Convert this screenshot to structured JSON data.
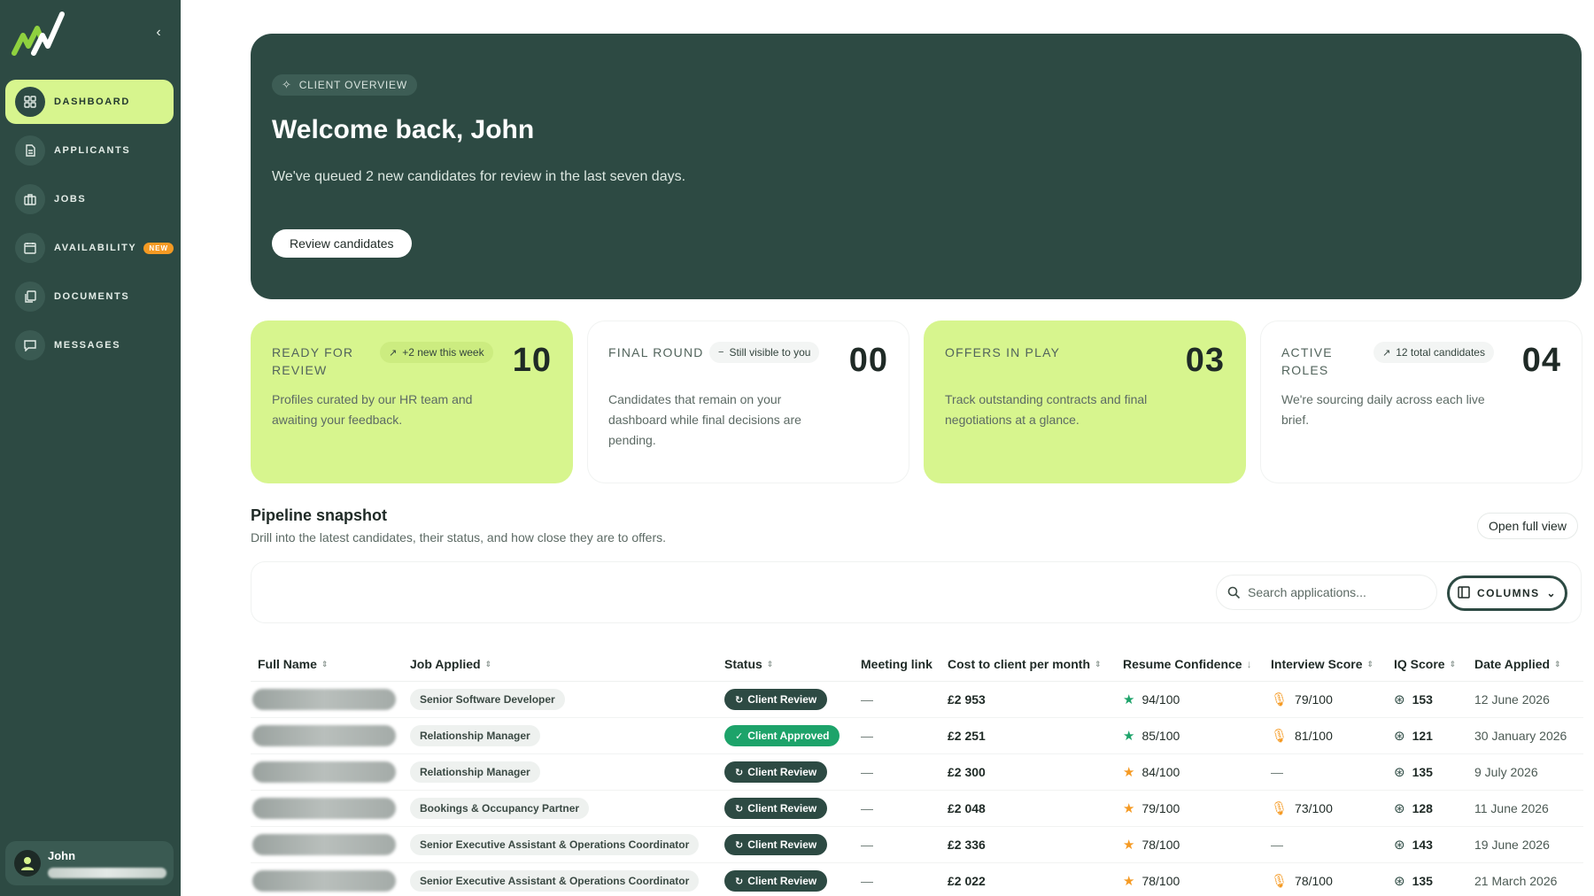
{
  "sidebar": {
    "items": [
      {
        "label": "DASHBOARD",
        "icon": "grid-icon",
        "active": true
      },
      {
        "label": "APPLICANTS",
        "icon": "file-icon"
      },
      {
        "label": "JOBS",
        "icon": "briefcase-icon"
      },
      {
        "label": "AVAILABILITY",
        "icon": "calendar-icon",
        "badge": "NEW"
      },
      {
        "label": "DOCUMENTS",
        "icon": "documents-icon"
      },
      {
        "label": "MESSAGES",
        "icon": "message-icon"
      }
    ],
    "user": {
      "name": "John"
    }
  },
  "hero": {
    "chip": "CLIENT OVERVIEW",
    "title": "Welcome back, John",
    "subtitle": "We've queued 2 new candidates for review in the last seven days.",
    "button": "Review candidates"
  },
  "stats": [
    {
      "label": "READY FOR REVIEW",
      "tag": "+2 new this week",
      "value": "10",
      "desc": "Profiles curated by our HR team and awaiting your feedback."
    },
    {
      "label": "FINAL ROUND",
      "tag": "Still visible to you",
      "value": "00",
      "desc": "Candidates that remain on your dashboard while final decisions are pending."
    },
    {
      "label": "OFFERS IN PLAY",
      "tag": "",
      "value": "03",
      "desc": "Track outstanding contracts and final negotiations at a glance."
    },
    {
      "label": "ACTIVE ROLES",
      "tag": "12 total candidates",
      "value": "04",
      "desc": "We're sourcing daily across each live brief."
    }
  ],
  "pipeline": {
    "title": "Pipeline snapshot",
    "subtitle": "Drill into the latest candidates, their status, and how close they are to offers.",
    "open_full": "Open full view",
    "search_placeholder": "Search applications...",
    "columns_label": "COLUMNS"
  },
  "table": {
    "headers": [
      "Full Name",
      "Job Applied",
      "Status",
      "Meeting link",
      "Cost to client per month",
      "Resume Confidence",
      "Interview Score",
      "IQ Score",
      "Date Applied"
    ],
    "rows": [
      {
        "job": "Senior Software Developer",
        "status": "Client Review",
        "meeting": "—",
        "cost": "£2 953",
        "resume": "94/100",
        "interview": "79/100",
        "iq": "153",
        "date": "12 June 2026"
      },
      {
        "job": "Relationship Manager",
        "status": "Client Approved",
        "meeting": "—",
        "cost": "£2 251",
        "resume": "85/100",
        "interview": "81/100",
        "iq": "121",
        "date": "30 January 2026"
      },
      {
        "job": "Relationship Manager",
        "status": "Client Review",
        "meeting": "—",
        "cost": "£2 300",
        "resume": "84/100",
        "interview": "—",
        "iq": "135",
        "date": "9 July 2026"
      },
      {
        "job": "Bookings & Occupancy Partner",
        "status": "Client Review",
        "meeting": "—",
        "cost": "£2 048",
        "resume": "79/100",
        "interview": "73/100",
        "iq": "128",
        "date": "11 June 2026"
      },
      {
        "job": "Senior Executive Assistant & Operations Coordinator",
        "status": "Client Review",
        "meeting": "—",
        "cost": "£2 336",
        "resume": "78/100",
        "interview": "—",
        "iq": "143",
        "date": "19 June 2026"
      },
      {
        "job": "Senior Executive Assistant & Operations Coordinator",
        "status": "Client Review",
        "meeting": "—",
        "cost": "£2 022",
        "resume": "78/100",
        "interview": "78/100",
        "iq": "135",
        "date": "21 March 2026"
      }
    ]
  },
  "colors": {
    "primary": "#2d4a43",
    "accent": "#d7f58e",
    "approved": "#1da36a",
    "warning": "#f59a23"
  }
}
